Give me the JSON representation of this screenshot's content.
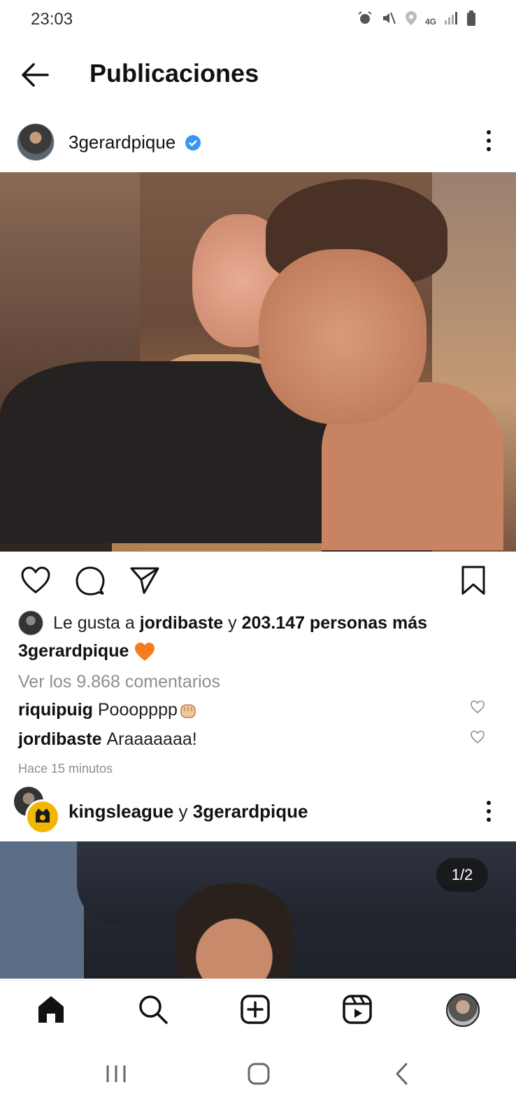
{
  "status": {
    "time": "23:03",
    "icons": [
      "alarm-icon",
      "mute-icon",
      "location-icon",
      "4g-icon",
      "signal-icon",
      "battery-icon"
    ],
    "network": "4G"
  },
  "header": {
    "title": "Publicaciones",
    "back_icon": "back-arrow-icon"
  },
  "post": {
    "username": "3gerardpique",
    "verified": true,
    "liked_by_prefix": "Le gusta a ",
    "liked_by_user": "jordibaste",
    "liked_by_join": " y ",
    "liked_by_others": "203.147 personas más",
    "caption_user": "3gerardpique",
    "view_comments": "Ver los 9.868 comentarios",
    "comments": [
      {
        "user": "riquipuig",
        "text": "Pooopppp"
      },
      {
        "user": "jordibaste",
        "text": "Araaaaaaa!"
      }
    ],
    "timestamp": "Hace 15 minutos"
  },
  "next_post": {
    "user1": "kingsleague",
    "join": " y ",
    "user2": "3gerardpique",
    "counter": "1/2"
  },
  "colors": {
    "verified": "#3897f0",
    "heart_emoji": "#f57c1f",
    "muted_text": "#8e8e8e"
  },
  "nav": [
    "home-icon",
    "search-icon",
    "create-icon",
    "reels-icon",
    "profile-avatar"
  ]
}
